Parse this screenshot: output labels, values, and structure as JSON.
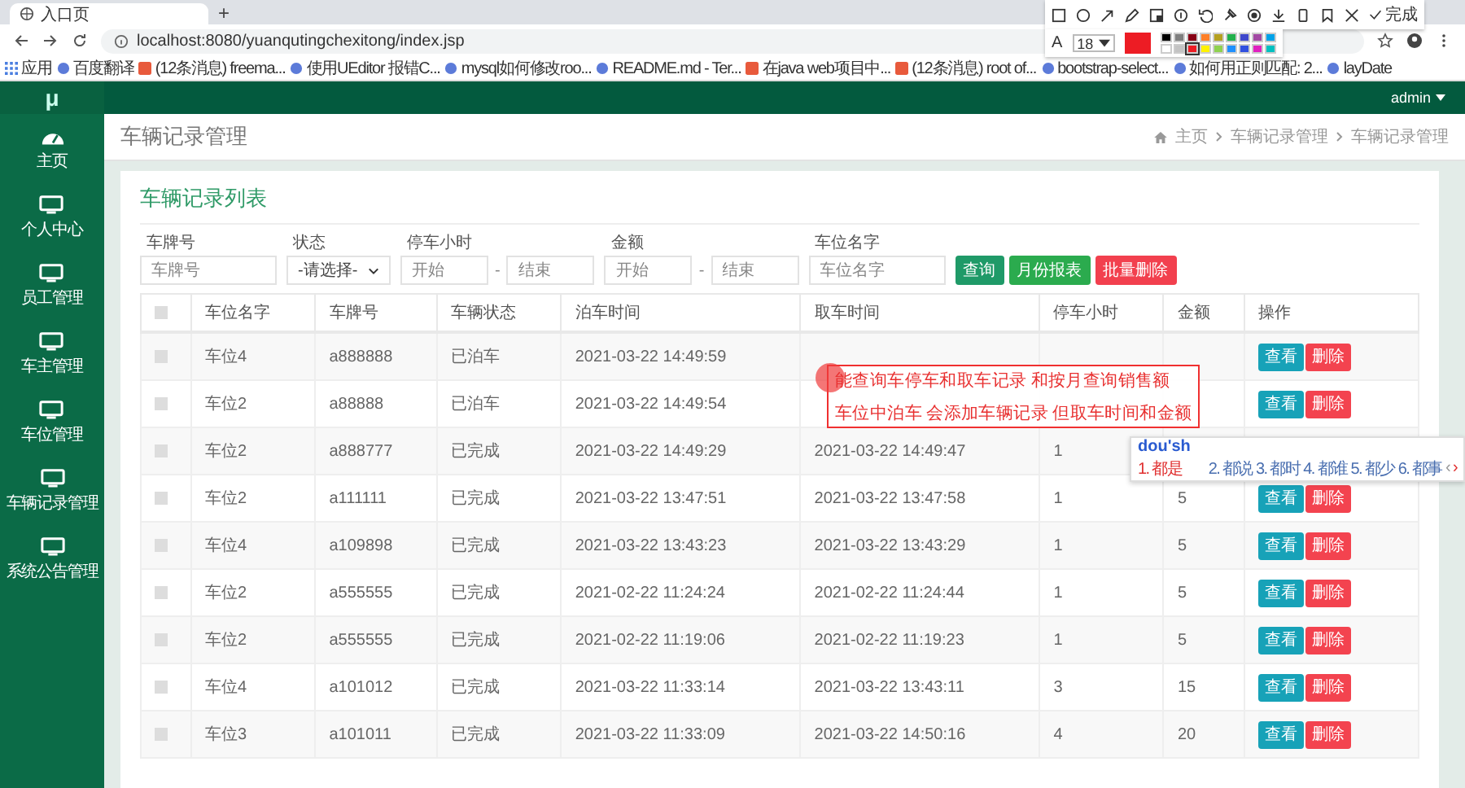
{
  "browser": {
    "tab_title": "入口页",
    "new_tab": "+",
    "url": "localhost:8080/yuanqutingchexitong/index.jsp",
    "bookmarks": [
      {
        "label": "应用",
        "kind": "apps"
      },
      {
        "label": "百度翻译",
        "kind": "site"
      },
      {
        "label": "(12条消息) freema...",
        "kind": "csdn"
      },
      {
        "label": "使用UEditor 报错C...",
        "kind": "site"
      },
      {
        "label": "mysql如何修改roo...",
        "kind": "site"
      },
      {
        "label": "README.md - Ter...",
        "kind": "site"
      },
      {
        "label": "在java web项目中...",
        "kind": "csdn"
      },
      {
        "label": "(12条消息) root of...",
        "kind": "csdn"
      },
      {
        "label": "bootstrap-select...",
        "kind": "site"
      },
      {
        "label": "如何用正则匹配: 2...",
        "kind": "site"
      },
      {
        "label": "layDate",
        "kind": "site"
      }
    ]
  },
  "capture_toolbar": {
    "done": "完成",
    "text_label": "A",
    "font_size": "18",
    "palette": [
      {
        "color": "#000000",
        "selected": false
      },
      {
        "color": "#7f7f7f",
        "selected": false
      },
      {
        "color": "#880015",
        "selected": false
      },
      {
        "color": "#ff7f27",
        "selected": false
      },
      {
        "color": "#b5a020",
        "selected": false
      },
      {
        "color": "#22b14c",
        "selected": false
      },
      {
        "color": "#3f48cc",
        "selected": false
      },
      {
        "color": "#a349a4",
        "selected": false
      },
      {
        "color": "#00a2e8",
        "selected": false
      },
      {
        "color": "#ffffff",
        "selected": false
      },
      {
        "color": "#c3c3c3",
        "selected": false
      },
      {
        "color": "#ed1c24",
        "selected": true
      },
      {
        "color": "#fff200",
        "selected": false
      },
      {
        "color": "#8fd14f",
        "selected": false
      },
      {
        "color": "#1e90ff",
        "selected": false
      },
      {
        "color": "#3050e0",
        "selected": false
      },
      {
        "color": "#e020c0",
        "selected": false
      },
      {
        "color": "#00c0c0",
        "selected": false
      }
    ]
  },
  "app": {
    "logo": "μ",
    "user": "admin",
    "sidebar": [
      {
        "label": "主页",
        "kind": "dashboard"
      },
      {
        "label": "个人中心",
        "kind": "page"
      },
      {
        "label": "员工管理",
        "kind": "page"
      },
      {
        "label": "车主管理",
        "kind": "page"
      },
      {
        "label": "车位管理",
        "kind": "page"
      },
      {
        "label": "车辆记录管理",
        "kind": "page"
      },
      {
        "label": "系统公告管理",
        "kind": "page"
      }
    ],
    "page_title": "车辆记录管理",
    "breadcrumb": [
      "主页",
      "车辆记录管理",
      "车辆记录管理"
    ],
    "card_title": "车辆记录列表",
    "filters": [
      {
        "label": "车牌号",
        "kind": "text",
        "placeholder": "车牌号"
      },
      {
        "label": "状态",
        "kind": "select",
        "value": "-请选择-"
      },
      {
        "label": "停车小时",
        "kind": "range",
        "fields": [
          {
            "placeholder": "开始"
          },
          {
            "placeholder": "结束"
          }
        ],
        "sep": "-"
      },
      {
        "label": "金额",
        "kind": "range",
        "fields": [
          {
            "placeholder": "开始"
          },
          {
            "placeholder": "结束"
          }
        ],
        "sep": "-"
      },
      {
        "label": "车位名字",
        "kind": "text",
        "placeholder": "车位名字"
      }
    ],
    "buttons": [
      {
        "label": "查询",
        "kind": "search"
      },
      {
        "label": "月份报表",
        "kind": "report"
      },
      {
        "label": "批量删除",
        "kind": "delete"
      }
    ],
    "table": {
      "select_all_checked": false,
      "columns": [
        "车位名字",
        "车牌号",
        "车辆状态",
        "泊车时间",
        "取车时间",
        "停车小时",
        "金额",
        "操作"
      ],
      "rows": [
        {
          "checked": false,
          "cells": [
            "车位4",
            "a888888",
            "已泊车",
            "2021-03-22 14:49:59"
          ],
          "actions": [
            "查看",
            "删除"
          ]
        },
        {
          "checked": false,
          "cells": [
            "车位2",
            "a88888",
            "已泊车",
            "2021-03-22 14:49:54"
          ],
          "actions": [
            "查看",
            "删除"
          ]
        },
        {
          "checked": false,
          "cells": [
            "车位2",
            "a888777",
            "已完成",
            "2021-03-22 14:49:29",
            "2021-03-22 14:49:47",
            "1"
          ]
        },
        {
          "checked": false,
          "cells": [
            "车位2",
            "a111111",
            "已完成",
            "2021-03-22 13:47:51",
            "2021-03-22 13:47:58",
            "1",
            "5"
          ],
          "actions": [
            "查看",
            "删除"
          ]
        },
        {
          "checked": false,
          "cells": [
            "车位4",
            "a109898",
            "已完成",
            "2021-03-22 13:43:23",
            "2021-03-22 13:43:29",
            "1",
            "5"
          ],
          "actions": [
            "查看",
            "删除"
          ]
        },
        {
          "checked": false,
          "cells": [
            "车位2",
            "a555555",
            "已完成",
            "2021-02-22 11:24:24",
            "2021-02-22 11:24:44",
            "1",
            "5"
          ],
          "actions": [
            "查看",
            "删除"
          ]
        },
        {
          "checked": false,
          "cells": [
            "车位2",
            "a555555",
            "已完成",
            "2021-02-22 11:19:06",
            "2021-02-22 11:19:23",
            "1",
            "5"
          ],
          "actions": [
            "查看",
            "删除"
          ]
        },
        {
          "checked": false,
          "cells": [
            "车位4",
            "a101012",
            "已完成",
            "2021-03-22 11:33:14",
            "2021-03-22 13:43:11",
            "3",
            "15"
          ],
          "actions": [
            "查看",
            "删除"
          ]
        },
        {
          "checked": false,
          "cells": [
            "车位3",
            "a101011",
            "已完成",
            "2021-03-22 11:33:09",
            "2021-03-22 14:50:16",
            "4",
            "20"
          ],
          "actions": [
            "查看",
            "删除"
          ]
        }
      ]
    }
  },
  "annotation": {
    "lines": [
      "能查询车停车和取车记录 和按月查询销售额",
      "车位中泊车 会添加车辆记录  但取车时间和金额"
    ]
  },
  "ime": {
    "input": "dou'sh",
    "candidates": [
      {
        "label": "1. 都是",
        "selected": true
      },
      {
        "label": "2. 都说",
        "selected": false
      },
      {
        "label": "3. 都时",
        "selected": false
      },
      {
        "label": "4. 都谁",
        "selected": false
      },
      {
        "label": "5. 都少",
        "selected": false
      },
      {
        "label": "6. 都事",
        "selected": false
      }
    ],
    "prev": "‹",
    "next": "›"
  }
}
